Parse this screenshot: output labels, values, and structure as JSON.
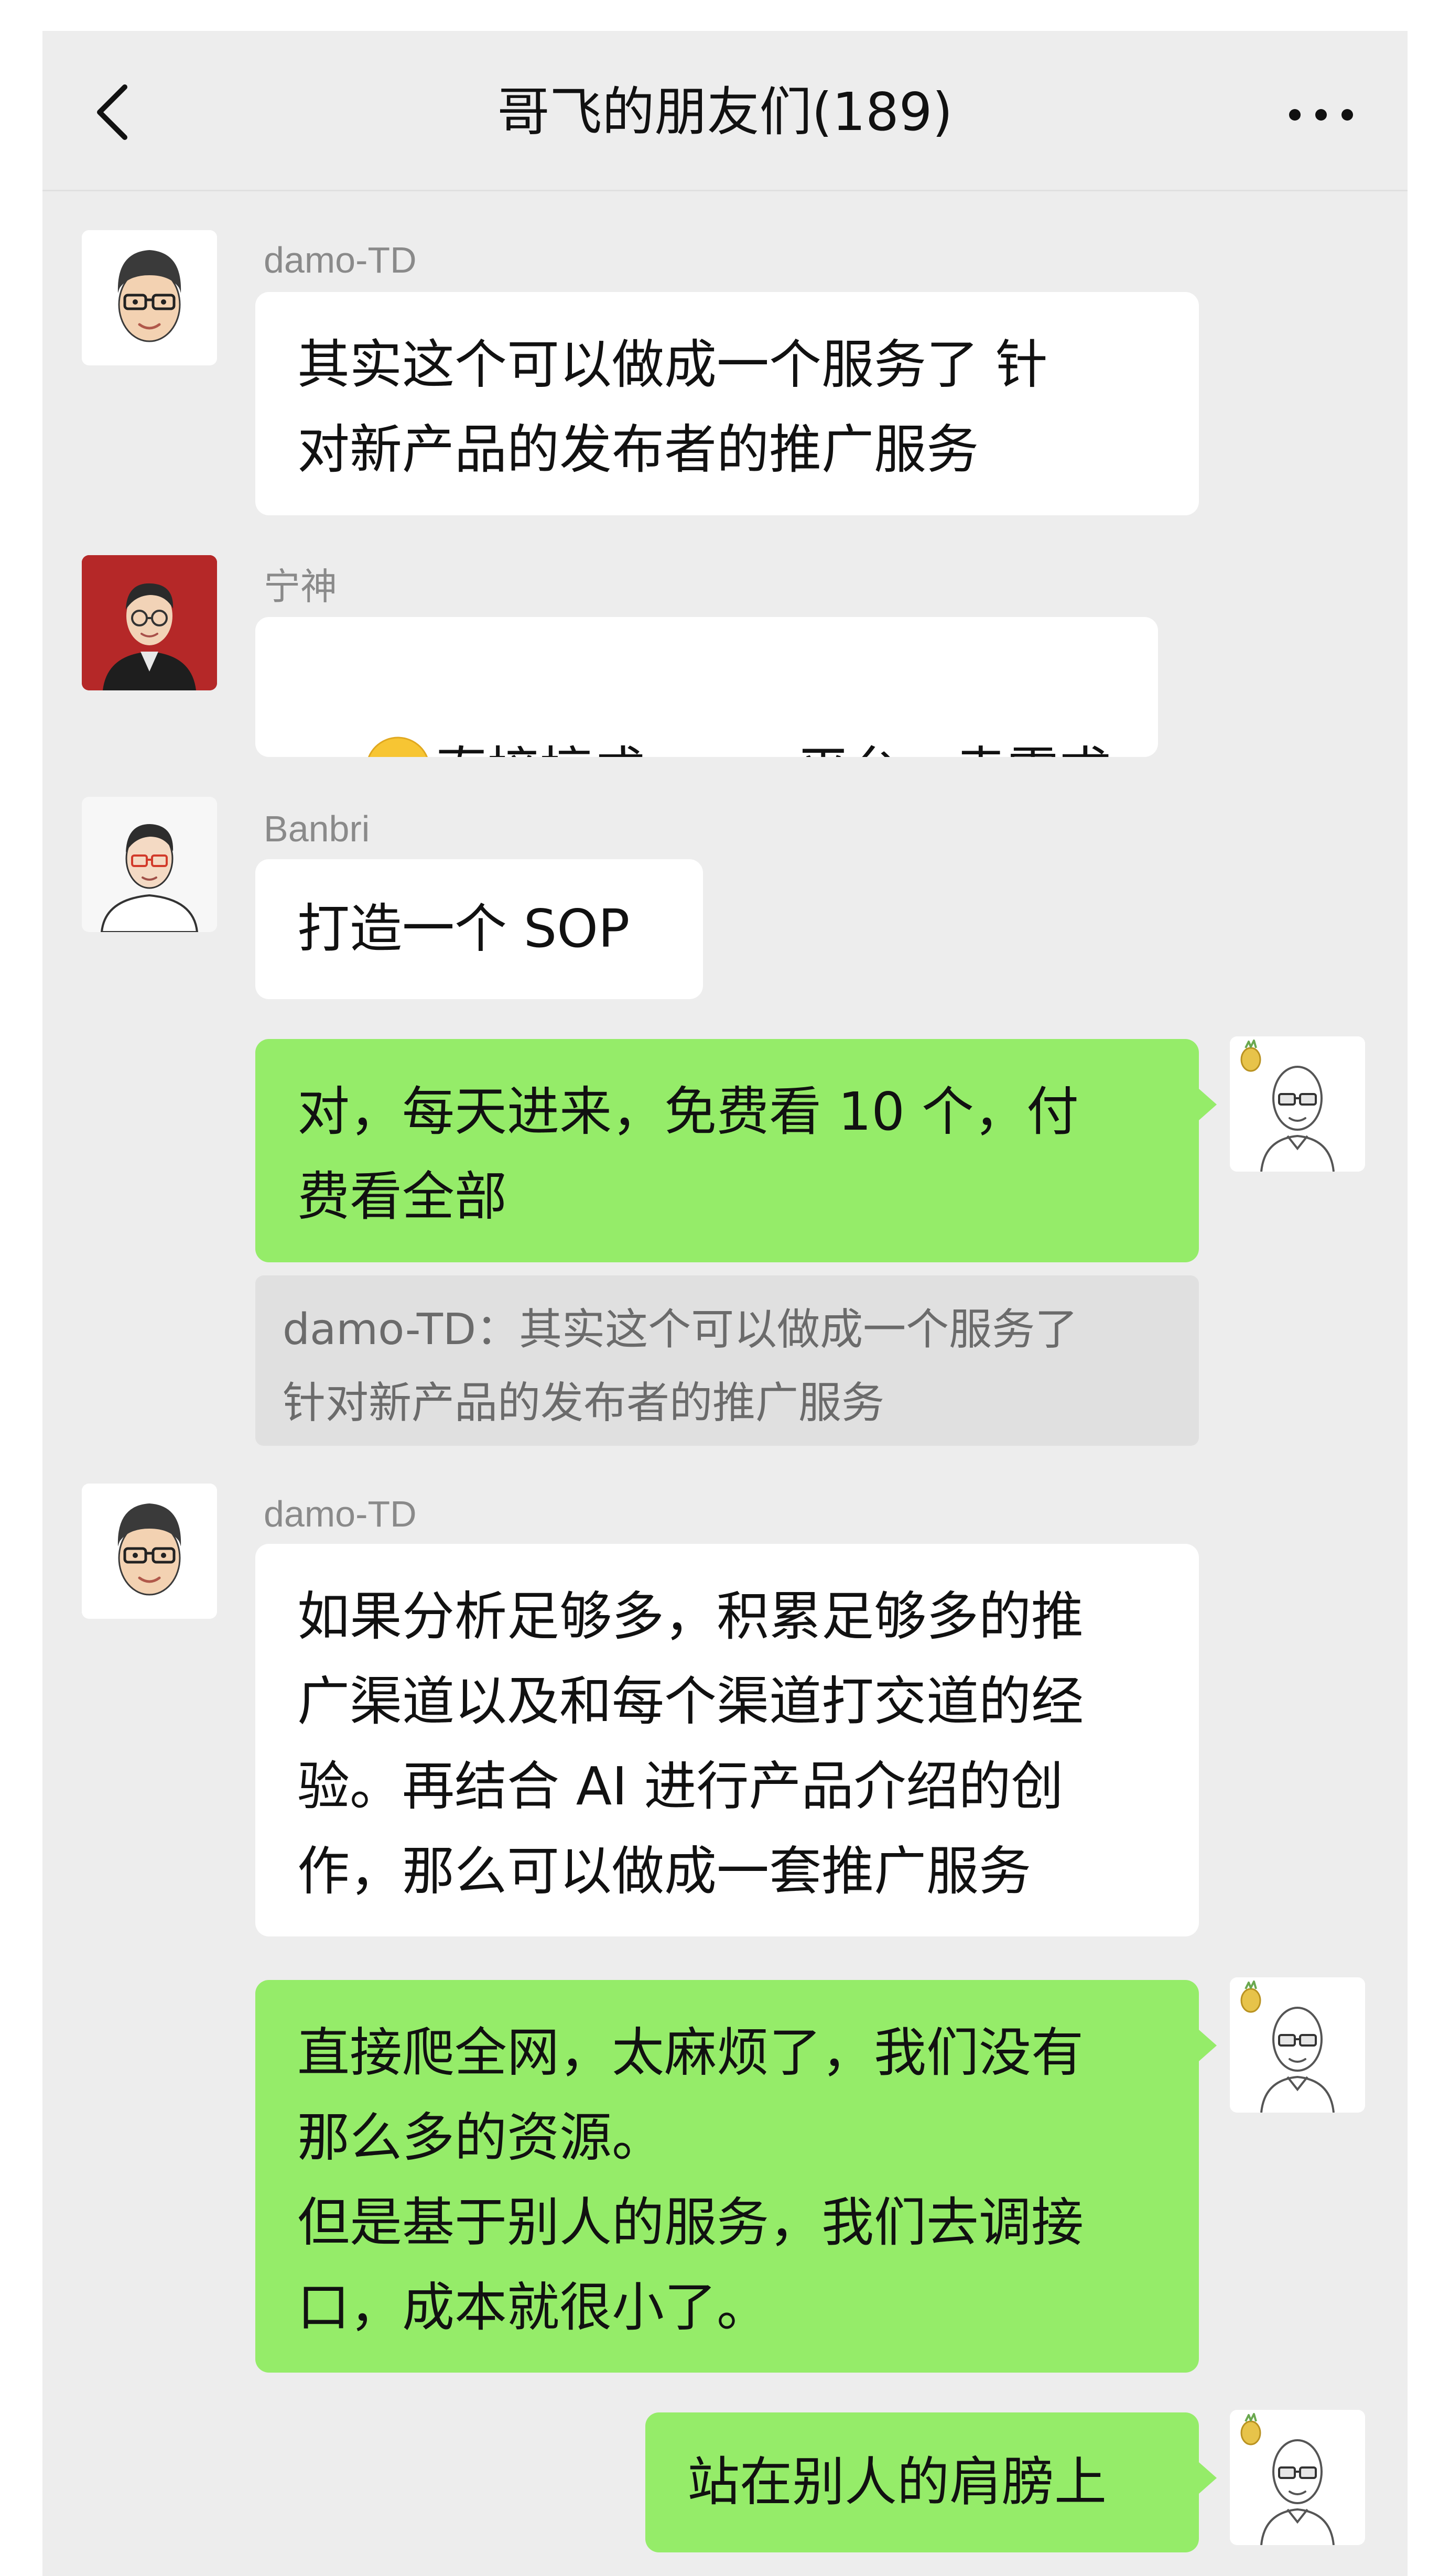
{
  "header": {
    "title": "哥飞的朋友们(189)",
    "back_icon": "chevron-left-icon",
    "more_icon": "more-horizontal-icon"
  },
  "messages": [
    {
      "sender": "damo-TD",
      "text": "其实这个可以做成一个服务了 针\n对新产品的发布者的推广服务"
    },
    {
      "sender": "宁神",
      "text": "直接搞成 saas 平台，卖需求",
      "emoji": "grinning-squinting-face-emoji"
    },
    {
      "sender": "Banbri",
      "text": "打造一个 SOP"
    },
    {
      "sender": "me",
      "text": "对，每天进来，免费看 10 个，付\n费看全部"
    },
    {
      "quote": "damo-TD：其实这个可以做成一个服务了\n针对新产品的发布者的推广服务"
    },
    {
      "sender": "damo-TD",
      "text": "如果分析足够多，积累足够多的推\n广渠道以及和每个渠道打交道的经\n验。再结合 AI 进行产品介绍的创\n作，那么可以做成一套推广服务"
    },
    {
      "sender": "me",
      "text": "直接爬全网，太麻烦了，我们没有\n那么多的资源。\n但是基于别人的服务，我们去调接\n口，成本就很小了。"
    },
    {
      "sender": "me",
      "text": "站在别人的肩膀上"
    }
  ],
  "colors": {
    "background": "#ededed",
    "bubble_other": "#ffffff",
    "bubble_self": "#95ec69",
    "quote_bg": "#e0e0e0",
    "sender_name": "#8a8a8a"
  }
}
